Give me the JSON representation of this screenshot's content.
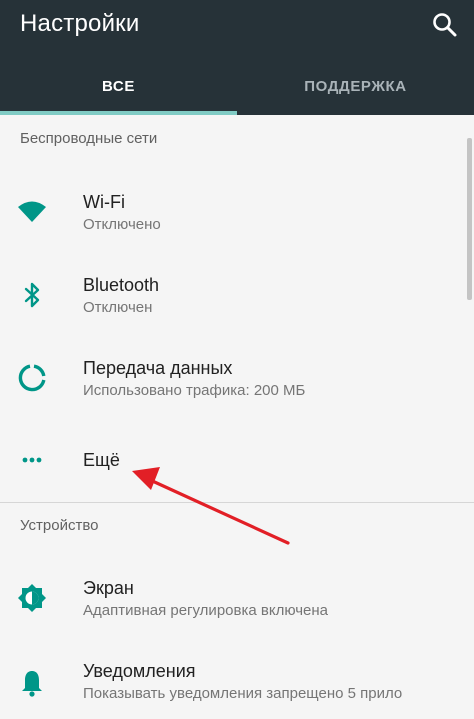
{
  "header": {
    "title": "Настройки",
    "icons": {
      "search": "search-icon"
    },
    "tabs": [
      {
        "label": "ВСЕ",
        "active": true
      },
      {
        "label": "ПОДДЕРЖКА",
        "active": false
      }
    ]
  },
  "sections": [
    {
      "title": "Беспроводные сети",
      "items": [
        {
          "label": "Wi-Fi",
          "sub": "Отключено",
          "icon": "wifi-icon"
        },
        {
          "label": "Bluetooth",
          "sub": "Отключен",
          "icon": "bluetooth-icon"
        },
        {
          "label": "Передача данных",
          "sub": "Использовано трафика: 200 МБ",
          "icon": "data-usage-icon"
        },
        {
          "label": "Ещё",
          "icon": "more-dots-icon"
        }
      ]
    },
    {
      "title": "Устройство",
      "items": [
        {
          "label": "Экран",
          "sub": "Адаптивная регулировка включена",
          "icon": "display-brightness-icon"
        },
        {
          "label": "Уведомления",
          "sub": "Показывать уведомления запрещено 5 прило",
          "icon": "notifications-bell-icon"
        }
      ]
    }
  ],
  "colors": {
    "appbar": "#263238",
    "accent": "#009688",
    "tab_indicator": "#80cbc4",
    "annotation_arrow": "#e21f26"
  }
}
